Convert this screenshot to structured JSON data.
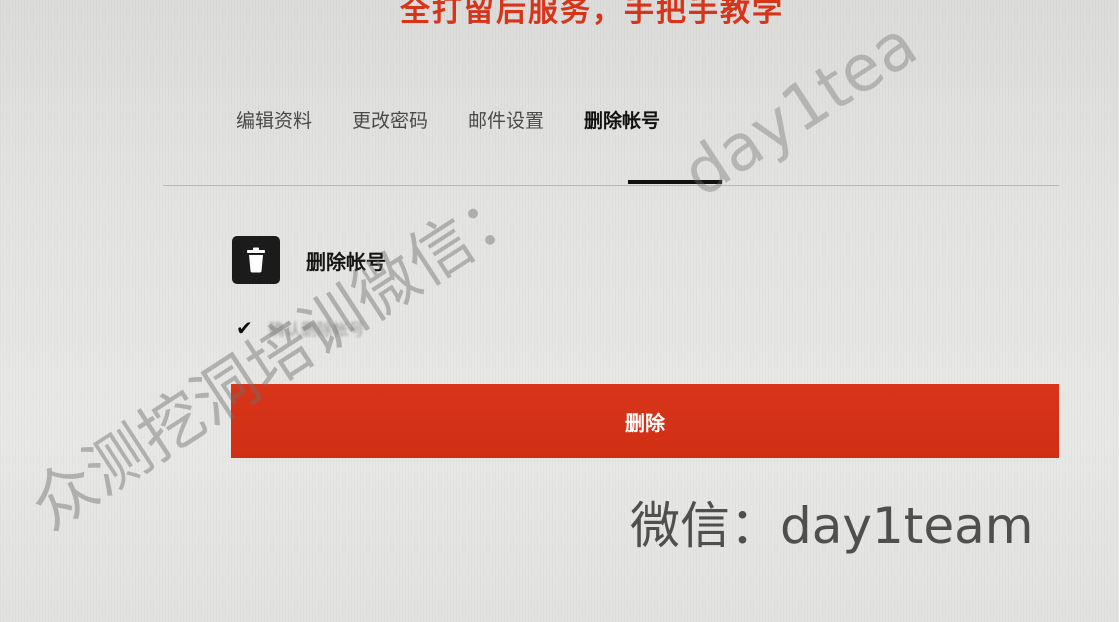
{
  "banner": {
    "text": "全打留后服务，手把手教学"
  },
  "tabs": [
    {
      "label": "编辑资料",
      "active": false
    },
    {
      "label": "更改密码",
      "active": false
    },
    {
      "label": "邮件设置",
      "active": false
    },
    {
      "label": "删除帐号",
      "active": true
    }
  ],
  "section": {
    "icon": "trash-icon",
    "title": "删除帐号"
  },
  "confirm": {
    "icon": "check-icon",
    "text": "确认删除帐号"
  },
  "delete_button": {
    "label": "删除"
  },
  "overlay": {
    "wechat": "微信：day1team",
    "watermark_left": "众测挖洞培训微信：",
    "watermark_right": "day1tea"
  },
  "colors": {
    "accent": "#d8351a",
    "text_dark": "#151515",
    "background": "#e4e4e2"
  }
}
